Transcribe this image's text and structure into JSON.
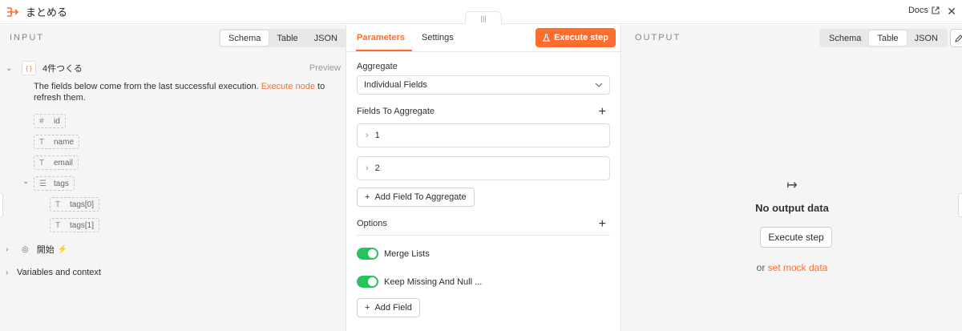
{
  "header": {
    "title": "まとめる",
    "docs_label": "Docs",
    "close_glyph": "✕",
    "drag_glyph": "|||"
  },
  "input_panel": {
    "label": "INPUT",
    "view_tabs": [
      "Schema",
      "Table",
      "JSON"
    ],
    "active_view": "Schema",
    "node": {
      "icon_glyph": "{ }",
      "name": "4件つくる",
      "preview_label": "Preview"
    },
    "description": {
      "text_before": "The fields below come from the last successful execution. ",
      "link": "Execute node",
      "text_after": " to refresh them."
    },
    "fields": [
      {
        "icon": "#",
        "name": "id"
      },
      {
        "icon": "T",
        "name": "name"
      },
      {
        "icon": "T",
        "name": "email"
      },
      {
        "icon": "☰",
        "name": "tags"
      },
      {
        "icon": "T",
        "name": "tags[0]"
      },
      {
        "icon": "T",
        "name": "tags[1]"
      }
    ],
    "start_node": {
      "name": "開始",
      "icon_glyph": "◎",
      "bolt_glyph": "⚡"
    },
    "variables_label": "Variables and context"
  },
  "parameters_panel": {
    "tabs": [
      "Parameters",
      "Settings"
    ],
    "active_tab": "Parameters",
    "execute_button": "Execute step",
    "aggregate_label": "Aggregate",
    "aggregate_value": "Individual Fields",
    "fields_to_aggregate_label": "Fields To Aggregate",
    "field_items": [
      "1",
      "2"
    ],
    "add_field_to_aggregate": "Add Field To Aggregate",
    "options_label": "Options",
    "toggles": [
      {
        "label": "Merge Lists",
        "on": true
      },
      {
        "label": "Keep Missing And Null ...",
        "on": true
      }
    ],
    "add_field": "Add Field",
    "plus_glyph": "+"
  },
  "output_panel": {
    "label": "OUTPUT",
    "view_tabs": [
      "Schema",
      "Table",
      "JSON"
    ],
    "active_view": "Table",
    "empty_icon_glyph": "↦",
    "empty_title": "No output data",
    "execute_button": "Execute step",
    "or_text": "or ",
    "mock_link": "set mock data"
  },
  "colors": {
    "accent": "#ff6d2e",
    "toggle_on": "#29c35e",
    "panel_bg": "#f5f5f5"
  }
}
